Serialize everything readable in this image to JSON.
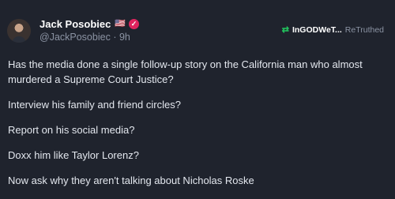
{
  "post": {
    "author": {
      "display_name": "Jack Posobiec",
      "flag": "🇺🇸",
      "verified_icon": "verified-badge-icon",
      "handle": "@JackPosobiec",
      "time": "9h"
    },
    "retruth": {
      "icon": "retruth-icon",
      "user": "InGODWeT...",
      "label": "ReTruthed"
    },
    "paragraphs": [
      "Has the media done a single follow-up story on the California man who almost murdered a Supreme Court Justice?",
      "Interview his family and friend circles?",
      "Report on his social media?",
      "Doxx him like Taylor Lorenz?",
      "Now ask why they aren't talking about Nicholas Roske"
    ]
  },
  "colors": {
    "background": "#1f232d",
    "verified": "#e0245e",
    "retruth_green": "#22c55e",
    "muted": "#8b93a3"
  }
}
